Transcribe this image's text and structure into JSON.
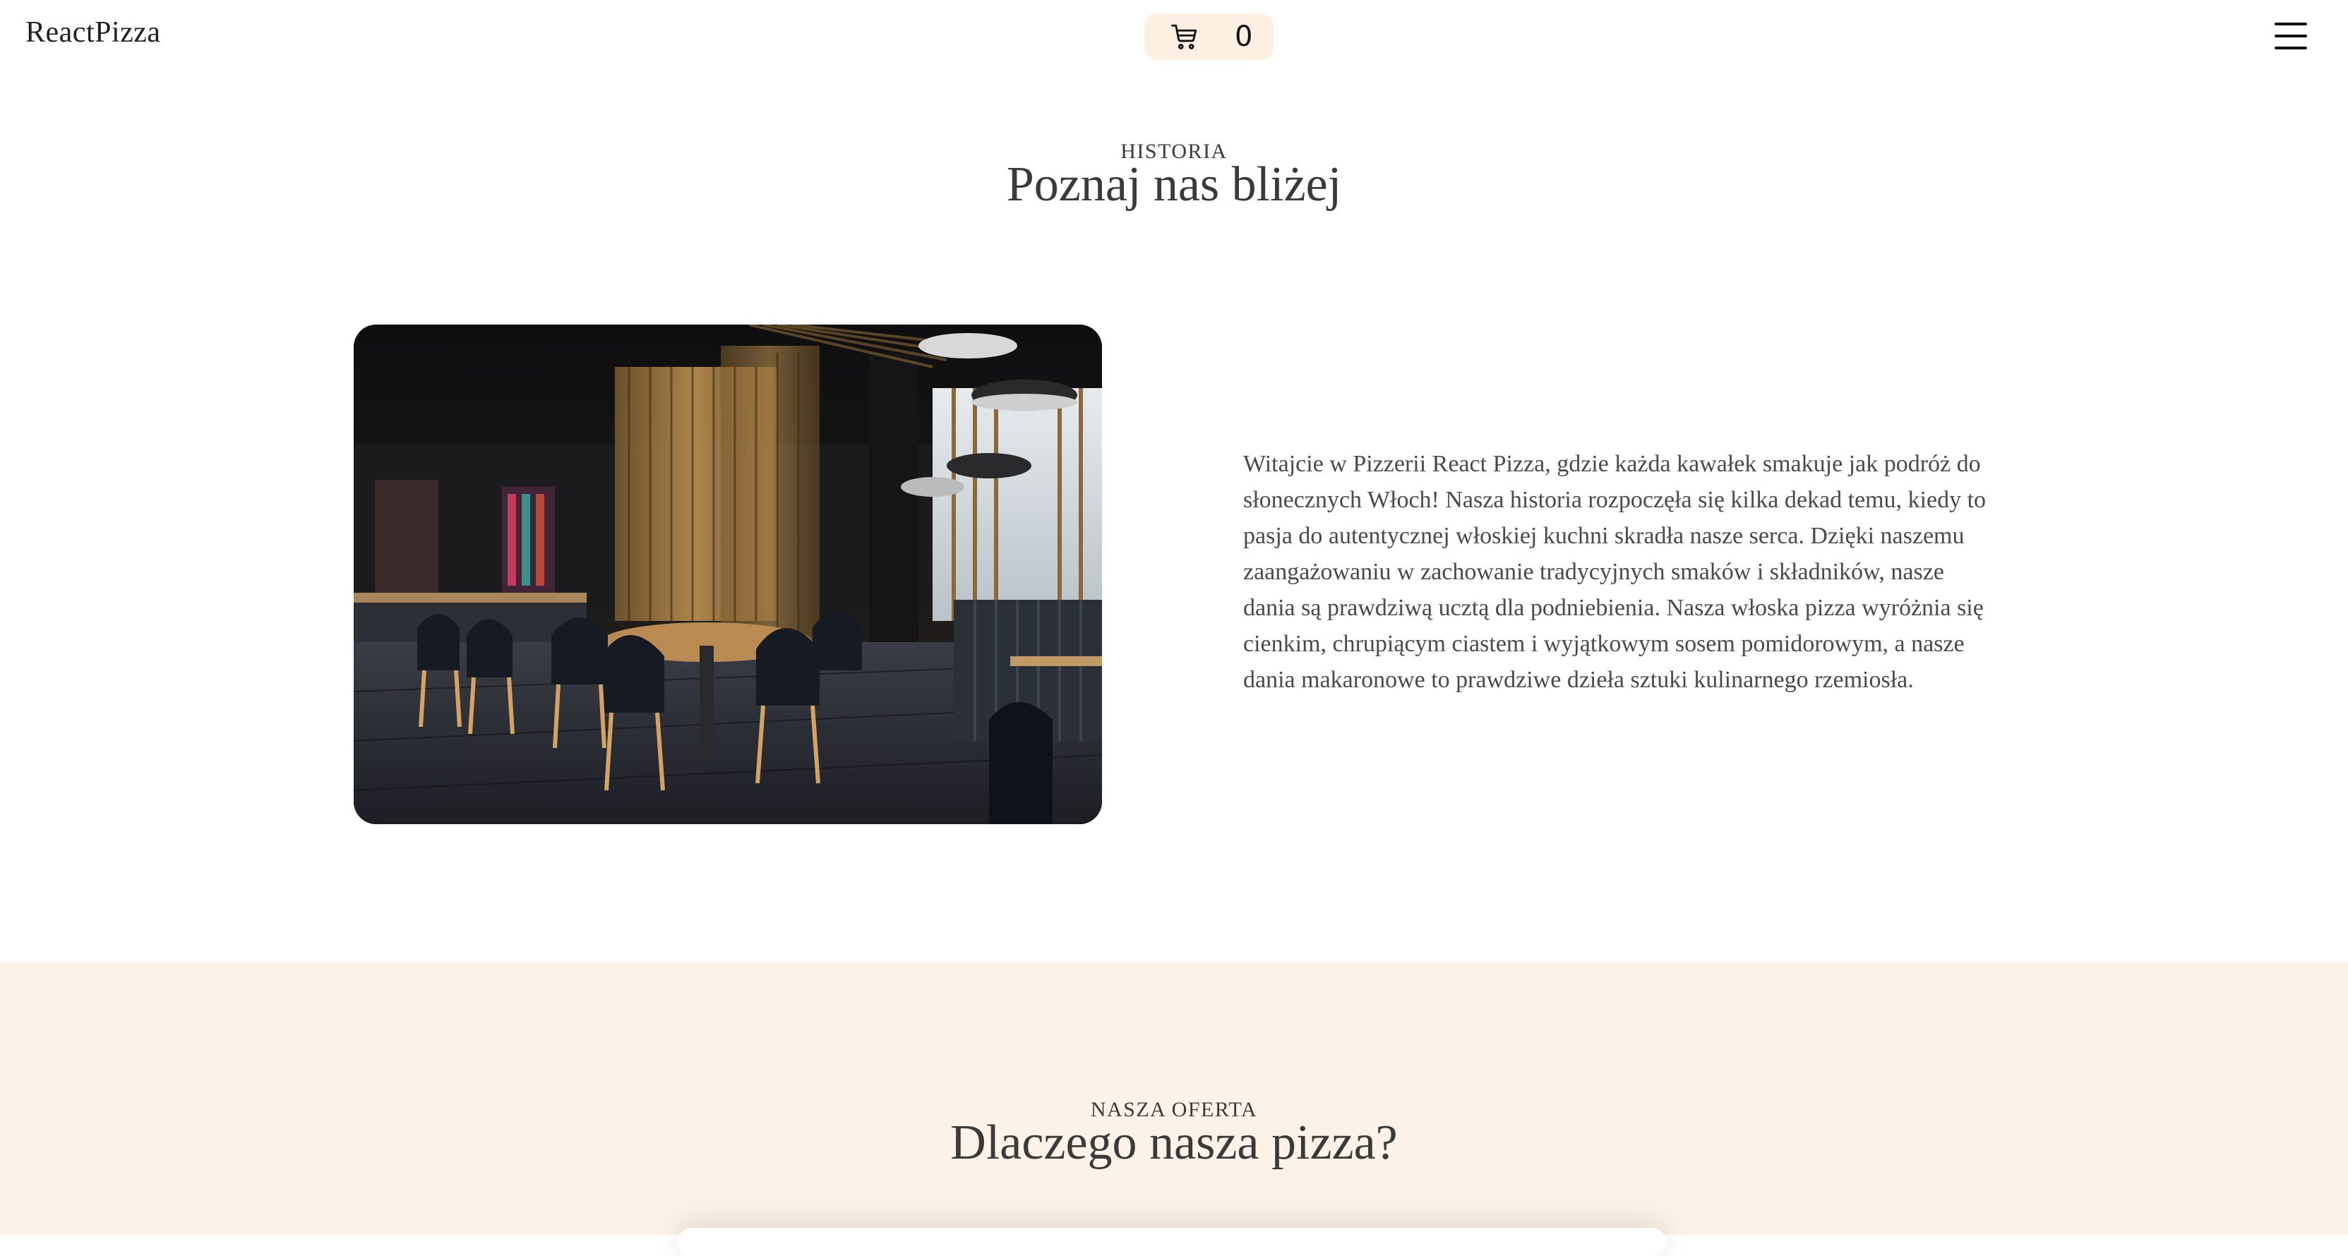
{
  "header": {
    "logo": "ReactPizza",
    "cart_icon": "cart-icon",
    "cart_count": "0",
    "menu_icon": "hamburger-menu-icon"
  },
  "history": {
    "eyebrow": "HISTORIA",
    "title": "Poznaj nas bliżej",
    "image_alt": "restaurant-interior-photo",
    "text": "Witajcie w Pizzerii React Pizza, gdzie każda kawałek smakuje jak podróż do słonecznych Włoch! Nasza historia rozpoczęła się kilka dekad temu, kiedy to pasja do autentycznej włoskiej kuchni skradła nasze serca. Dzięki naszemu zaangażowaniu w zachowanie tradycyjnych smaków i składników, nasze dania są prawdziwą ucztą dla podniebienia. Nasza włoska pizza wyróżnia się cienkim, chrupiącym ciastem i wyjątkowym sosem pomidorowym, a nasze dania makaronowe to prawdziwe dzieła sztuki kulinarnego rzemiosła."
  },
  "offer": {
    "eyebrow": "NASZA OFERTA",
    "title": "Dlaczego nasza pizza?"
  },
  "colors": {
    "cart_bg": "#fdf0e3",
    "offer_bg": "#fdf2e7",
    "text": "#3a3a3a"
  }
}
